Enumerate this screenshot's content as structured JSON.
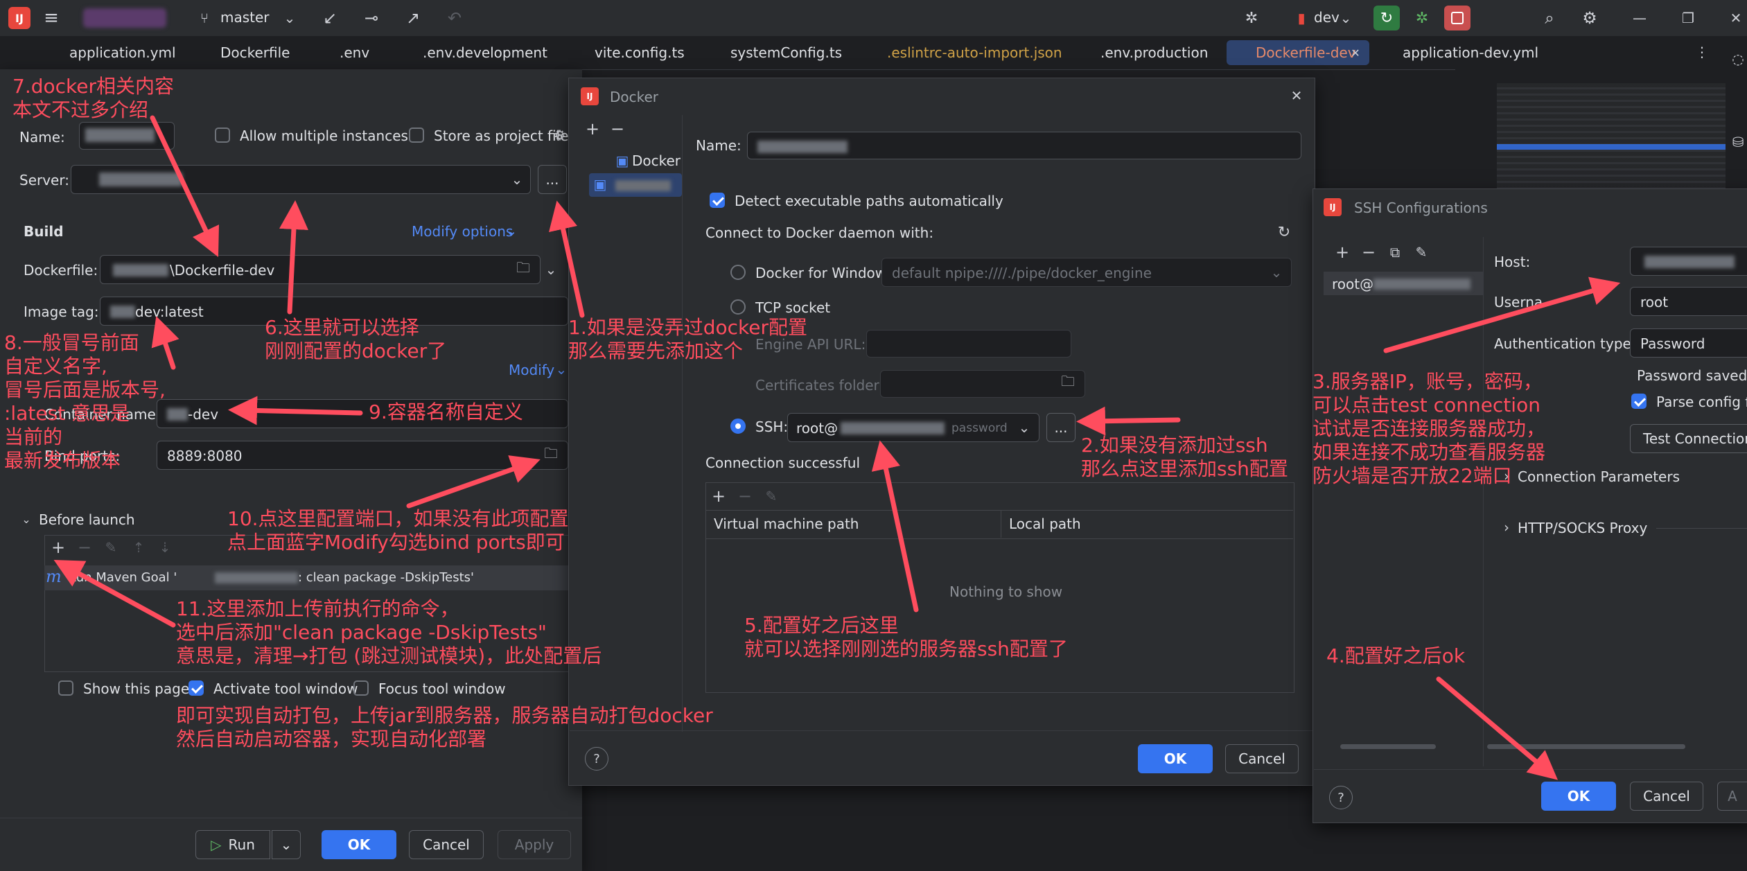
{
  "toolbar": {
    "branch": "master",
    "run_config": "dev"
  },
  "tabs": [
    "application.yml",
    "Dockerfile",
    ".env",
    ".env.development",
    "vite.config.ts",
    "systemConfig.ts",
    ".eslintrc-auto-import.json",
    ".env.production",
    "Dockerfile-dev",
    "application-dev.yml"
  ],
  "run_dialog": {
    "name_label": "Name:",
    "allow_multiple": "Allow multiple instances",
    "store_project": "Store as project file",
    "server_label": "Server:",
    "build_heading": "Build",
    "modify_options": "Modify options",
    "dockerfile_label": "Dockerfile:",
    "dockerfile_value": "\\Dockerfile-dev",
    "image_tag_label": "Image tag:",
    "image_tag_value": "dev:latest",
    "modify": "Modify",
    "container_name_label": "Container name:",
    "container_name_value": "-dev",
    "bind_ports_label": "Bind ports:",
    "bind_ports_value": "8889:8080",
    "before_launch": "Before launch",
    "launch_task": "Run Maven Goal '",
    "launch_task_suffix": ": clean package -DskipTests'",
    "show_page": "Show this page",
    "activate_tool": "Activate tool window",
    "focus_tool": "Focus tool window",
    "run_btn": "Run",
    "ok_btn": "OK",
    "cancel_btn": "Cancel",
    "apply_btn": "Apply"
  },
  "docker_dialog": {
    "title": "Docker",
    "tree_item": "Docker",
    "name_label": "Name:",
    "detect_paths": "Detect executable paths automatically",
    "connect_label": "Connect to Docker daemon with:",
    "docker_windows": "Docker for Windows",
    "docker_windows_value": "default  npipe:////./pipe/docker_engine",
    "tcp_socket": "TCP socket",
    "engine_api": "Engine API URL:",
    "certs_folder": "Certificates folder:",
    "ssh_label": "SSH:",
    "ssh_value": "root@",
    "ssh_auth": "password",
    "connection_status": "Connection successful",
    "col_vm": "Virtual machine path",
    "col_local": "Local path",
    "empty": "Nothing to show",
    "ok_btn": "OK",
    "cancel_btn": "Cancel"
  },
  "ssh_dialog": {
    "title": "SSH Configurations",
    "list_item": "root@",
    "host_label": "Host:",
    "username_label": "Userna",
    "username_value": "root",
    "auth_label": "Authentication type:",
    "auth_value": "Password",
    "password_saved": "Password saved pe",
    "parse_config": "Parse config file",
    "test_connection": "Test Connection",
    "conn_params": "Connection Parameters",
    "proxy": "HTTP/SOCKS Proxy",
    "ok_btn": "OK",
    "cancel_btn": "Cancel",
    "apply_btn": "A"
  },
  "annotations": {
    "a7": [
      "7.docker相关内容",
      "本文不过多介绍"
    ],
    "a8": [
      "8.一般冒号前面",
      "自定义名字,",
      "冒号后面是版本号,",
      ":latest 意思是",
      "当前的",
      "最新发布版本"
    ],
    "a6": [
      "6.这里就可以选择",
      "刚刚配置的docker了"
    ],
    "a1": [
      "1.如果是没弄过docker配置",
      "那么需要先添加这个"
    ],
    "a9": [
      "9.容器名称自定义"
    ],
    "a10": [
      "10.点这里配置端口，如果没有此项配置",
      "点上面蓝字Modify勾选bind ports即可"
    ],
    "a11": [
      "11.这里添加上传前执行的命令，",
      "选中后添加\"clean package -DskipTests\"",
      "意思是，清理→打包 (跳过测试模块)，此处配置后"
    ],
    "a11b": [
      "即可实现自动打包，上传jar到服务器，服务器自动打包docker",
      "然后自动启动容器，实现自动化部署"
    ],
    "a2": [
      "2.如果没有添加过ssh",
      "那么点这里添加ssh配置"
    ],
    "a5": [
      "5.配置好之后这里",
      "就可以选择刚刚选的服务器ssh配置了"
    ],
    "a3": [
      "3.服务器IP，账号，密码，",
      "可以点击test connection",
      "试试是否连接服务器成功，",
      "如果连接不成功查看服务器",
      "防火墙是否开放22端口"
    ],
    "a4": [
      "4.配置好之后ok"
    ]
  },
  "colors": {
    "accent": "#3574f0",
    "annotation": "#ff4d5e",
    "bg": "#1e1f22",
    "panel": "#2b2d30"
  }
}
